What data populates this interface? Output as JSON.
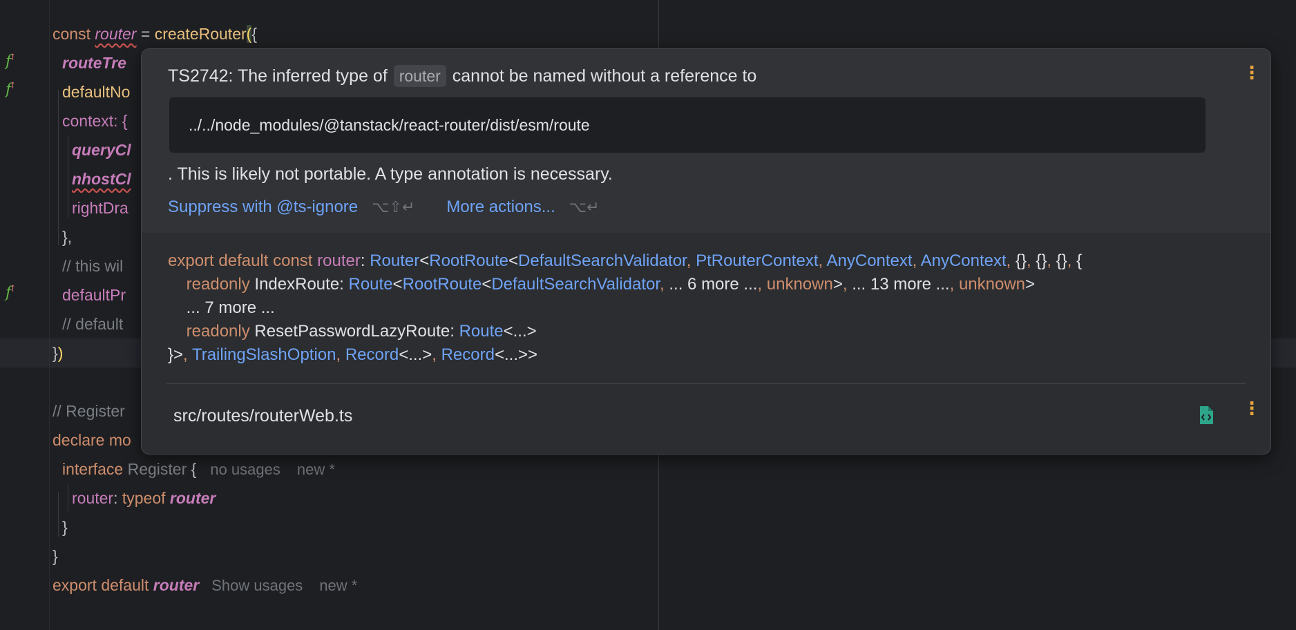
{
  "editor": {
    "lines": {
      "l1": {
        "kw": "const ",
        "var": "router",
        "eq": " = ",
        "fn": "createRouter",
        "paren": "(",
        "brace": "{"
      },
      "l2": {
        "text": "routeTre"
      },
      "l3": {
        "text": "defaultNo"
      },
      "l4": {
        "text": "context: {"
      },
      "l5": {
        "text": "queryCl"
      },
      "l6": {
        "text": "nhostCl"
      },
      "l7": {
        "text": "rightDra"
      },
      "l8": {
        "text": "},"
      },
      "l9": {
        "text": "// this wil"
      },
      "l10": {
        "text": "defaultPr"
      },
      "l11": {
        "text": "// default"
      },
      "l12": {
        "brace": "}",
        "paren": ")"
      },
      "l13": {
        "text": "// Register"
      },
      "l14": {
        "kw": "declare mo"
      },
      "l15": {
        "kw": "interface ",
        "name": "Register",
        "brace": " {",
        "hint1": "no usages",
        "hint2": "new *"
      },
      "l16": {
        "prop": "router",
        "colon": ": ",
        "kw": "typeof ",
        "var": "router"
      },
      "l17": {
        "text": "}"
      },
      "l18": {
        "text": "}"
      },
      "l19": {
        "kw": "export default ",
        "var": "router",
        "hint1": "Show usages",
        "hint2": "new *"
      }
    },
    "gutter_icons": [
      "function-override-icon",
      "function-override-icon",
      "function-override-icon"
    ]
  },
  "popup": {
    "error": {
      "prefix": "TS2742: The inferred type of ",
      "pill": "router",
      "suffix": " cannot be named without a reference to",
      "path": "../../node_modules/@tanstack/react-router/dist/esm/route",
      "line2": ". This is likely not portable. A type annotation is necessary.",
      "action1": "Suppress with @ts-ignore",
      "action1_keys": "⌥⇧↵",
      "action2": "More actions...",
      "action2_keys": "⌥↵"
    },
    "signature": {
      "r1": [
        "export default const ",
        "router",
        ": ",
        "Router",
        "<",
        "RootRoute",
        "<",
        "DefaultSearchValidator",
        ", ",
        "PtRouterContext",
        ", ",
        "AnyContext",
        ", ",
        "AnyContext",
        ", ",
        "{}",
        ", ",
        "{}",
        ", ",
        "{}",
        ", ",
        "{"
      ],
      "r2": [
        "    readonly ",
        "IndexRoute: ",
        "Route",
        "<",
        "RootRoute",
        "<",
        "DefaultSearchValidator",
        ", ",
        "... 6 more ...",
        ", ",
        "unknown",
        ">",
        ", ",
        "... 13 more ...",
        ", ",
        "unknown",
        ">"
      ],
      "r3": "    ... 7 more ...",
      "r4": [
        "    readonly ",
        "ResetPasswordLazyRoute: ",
        "Route",
        "<...>"
      ],
      "r5": [
        "}>",
        ", ",
        "TrailingSlashOption",
        ", ",
        "Record",
        "<...>",
        ", ",
        "Record",
        "<...>>"
      ]
    },
    "file": "src/routes/routerWeb.ts"
  }
}
